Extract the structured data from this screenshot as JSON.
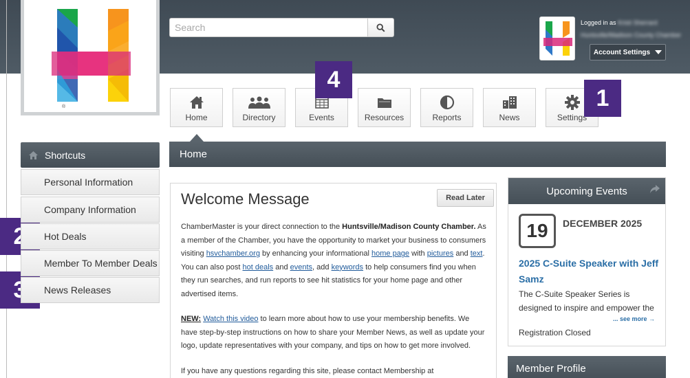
{
  "header": {
    "search_placeholder": "Search",
    "logged_in_prefix": "Logged in as",
    "logged_in_user": "Kristi Sherrard",
    "organization": "Huntsville/Madison County Chamber",
    "account_settings_label": "Account Settings"
  },
  "nav": {
    "items": [
      {
        "label": "Home",
        "icon": "house-icon"
      },
      {
        "label": "Directory",
        "icon": "people-icon"
      },
      {
        "label": "Events",
        "icon": "calendar-icon"
      },
      {
        "label": "Resources",
        "icon": "folder-icon"
      },
      {
        "label": "Reports",
        "icon": "pie-chart-icon"
      },
      {
        "label": "News",
        "icon": "building-icon"
      },
      {
        "label": "Settings",
        "icon": "gear-icon"
      }
    ]
  },
  "callouts": [
    "1",
    "2",
    "3",
    "4"
  ],
  "sidebar": {
    "header": "Shortcuts",
    "items": [
      {
        "label": "Personal Information"
      },
      {
        "label": "Company Information"
      },
      {
        "label": "Hot Deals"
      },
      {
        "label": "Member To Member Deals"
      },
      {
        "label": "News Releases"
      }
    ]
  },
  "main": {
    "bar_title": "Home",
    "welcome": {
      "title": "Welcome Message",
      "read_later": "Read Later",
      "p1": {
        "t1": "ChamberMaster is your direct connection to the ",
        "bold": "Huntsville/Madison County Chamber.",
        "t2": "  As a member of the Chamber, you have the opportunity to market your business to consumers visiting ",
        "link_site": "hsvchamber.org",
        "t3": " by enhancing your informational ",
        "link_home": "home page",
        "t4": " with ",
        "link_pictures": "pictures",
        "t5": " and ",
        "link_text": "text",
        "t6": ". You can also post ",
        "link_hot": "hot deals",
        "t7": " and ",
        "link_events": "events",
        "t8": ", add ",
        "link_keywords": "keywords",
        "t9": " to help consumers find you when they run searches, and run reports to see hit statistics for your home page and other advertised items."
      },
      "p2": {
        "new_label": "NEW:",
        "link_video": "Watch this video",
        "t1": " to learn more about how to use your membership benefits. We have step-by-step instructions on how to share your Member News, as well as update your logo, update representatives with your company, and tips on how to get more involved."
      },
      "p3": "If you have any questions regarding this site, please contact Membership at"
    }
  },
  "events": {
    "header": "Upcoming Events",
    "day": "19",
    "month_year": "DECEMBER 2025",
    "title": "2025 C-Suite Speaker with Jeff Samz",
    "description": "The C-Suite Speaker Series is designed to inspire and empower the",
    "see_more": "... see more →",
    "status": "Registration Closed"
  },
  "profile": {
    "header": "Member Profile"
  },
  "colors": {
    "header_bg": "#4a5560",
    "callout": "#4b2a83",
    "link": "#1f5a9a",
    "event_link": "#2a6ea6"
  }
}
